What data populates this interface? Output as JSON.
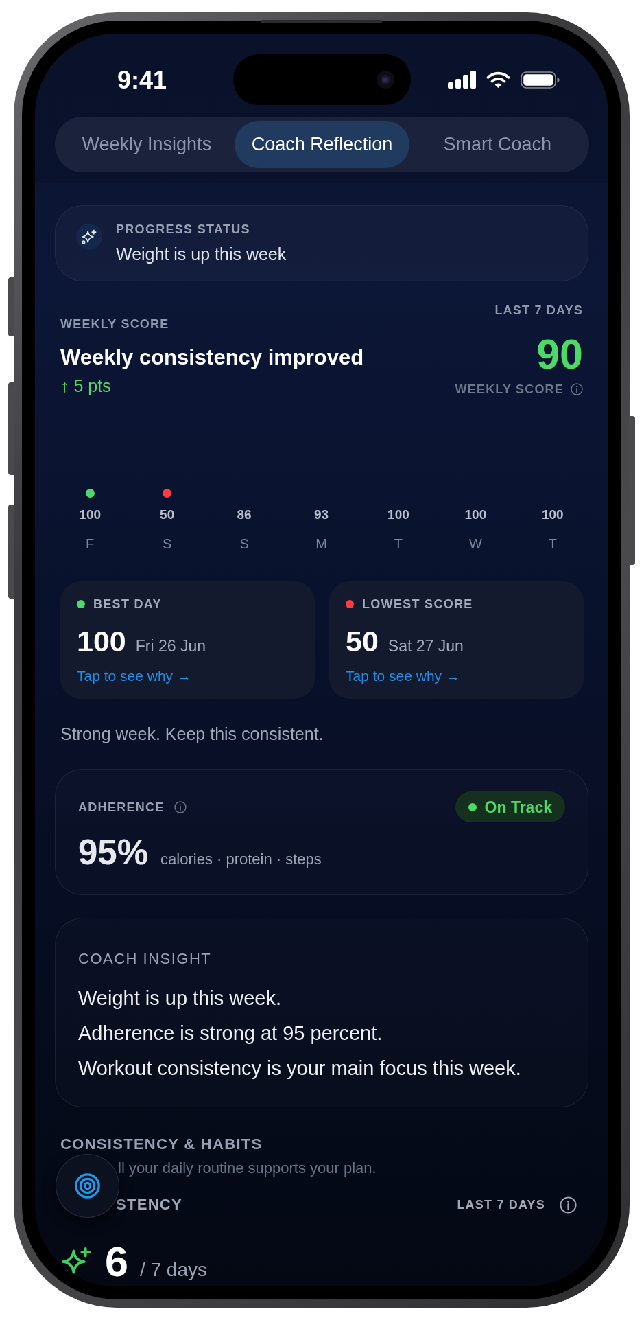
{
  "status_bar": {
    "time": "9:41"
  },
  "tabs": [
    {
      "label": "Weekly Insights",
      "selected": false
    },
    {
      "label": "Coach Reflection",
      "selected": true
    },
    {
      "label": "Smart Coach",
      "selected": false
    }
  ],
  "progress_status": {
    "title": "PROGRESS STATUS",
    "text": "Weight is up this week"
  },
  "weekly_score": {
    "label": "WEEKLY SCORE",
    "headline": "Weekly consistency improved",
    "change": "↑ 5 pts",
    "period": "LAST 7 DAYS",
    "score": "90",
    "score_caption": "WEEKLY SCORE"
  },
  "daily_scores": [
    {
      "value": "100",
      "day": "F",
      "color": "#4cd964"
    },
    {
      "value": "50",
      "day": "S",
      "color": "#ff3b3b"
    },
    {
      "value": "86",
      "day": "S"
    },
    {
      "value": "93",
      "day": "M"
    },
    {
      "value": "100",
      "day": "T"
    },
    {
      "value": "100",
      "day": "W"
    },
    {
      "value": "100",
      "day": "T"
    }
  ],
  "highlights": [
    {
      "title": "BEST DAY",
      "color": "#4cd964",
      "score": "100",
      "date": "Fri 26 Jun",
      "link": "Tap to see why →"
    },
    {
      "title": "LOWEST SCORE",
      "color": "#ff3b3b",
      "score": "50",
      "date": "Sat 27 Jun",
      "link": "Tap to see why →"
    }
  ],
  "summary": "Strong week. Keep this consistent.",
  "adherence": {
    "title": "ADHERENCE",
    "status": "On Track",
    "value": "95%",
    "detail": "calories · protein · steps"
  },
  "coach_insight": {
    "title": "COACH INSIGHT",
    "lines": [
      "Weight is up this week.",
      "Adherence is strong at 95 percent.",
      "Workout consistency is your main focus this week."
    ]
  },
  "consistency_habits": {
    "title": "CONSISTENCY & HABITS",
    "subtitle": "ll your daily routine supports your plan.",
    "metric_label": "STENCY",
    "period": "LAST 7 DAYS",
    "count": "6",
    "unit": "/ 7 days"
  }
}
